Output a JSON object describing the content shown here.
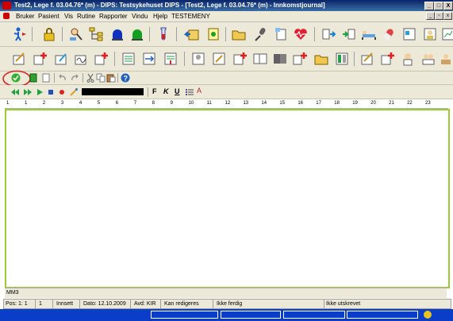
{
  "window": {
    "title": "Test2, Lege f. 03.04.76* (m) - DIPS: Testsykehuset DIPS - [Test2, Lege f. 03.04.76* (m) - Innkomstjournal]",
    "minimize": "_",
    "maximize": "□",
    "close": "X"
  },
  "menu": {
    "items": [
      "Bruker",
      "Pasient",
      "Vis",
      "Rutine",
      "Rapporter",
      "Vindu",
      "Hjelp",
      "TESTEMENY"
    ]
  },
  "format_bar": {
    "bold": "F",
    "italic": "K",
    "underline": "U",
    "font_size_label": "A"
  },
  "ruler": {
    "ticks": [
      "1",
      "1",
      "2",
      "3",
      "4",
      "5",
      "6",
      "7",
      "8",
      "9",
      "10",
      "11",
      "12",
      "13",
      "14",
      "15",
      "16",
      "17",
      "18",
      "19",
      "20",
      "21",
      "22",
      "23"
    ]
  },
  "editor": {
    "footer_label": "MM3"
  },
  "status_bar": {
    "position": "Pos: 1: 1",
    "line": "1",
    "mode": "Innsett",
    "date": "Dato: 12.10.2009",
    "department": "Avd: KIR",
    "edit_state": "Kan redigeres",
    "finished_state": "Ikke ferdig",
    "print_state": "Ikke utskrevet"
  },
  "colors": {
    "titlebar": "#0a246a",
    "editor_border": "#9acd32",
    "highlight_circle": "#e02020",
    "taskbar": "#0a3ec8"
  }
}
